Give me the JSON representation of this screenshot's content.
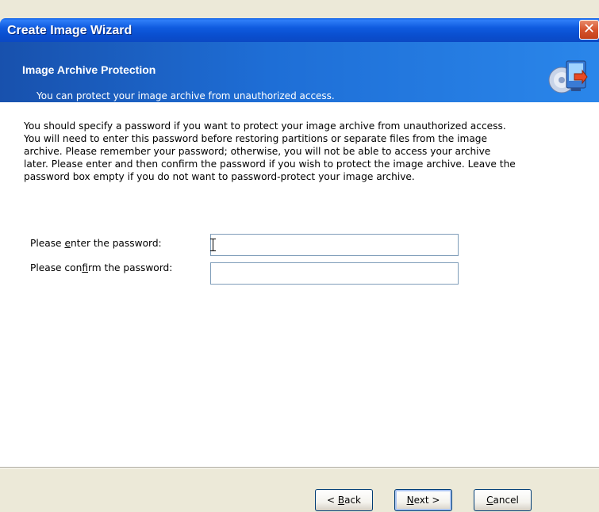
{
  "window": {
    "title": "Create Image Wizard",
    "close_glyph": "✕"
  },
  "header": {
    "title": "Image Archive Protection",
    "subtitle": "You can protect your image archive from unauthorized access.",
    "icon": "disc-computer-icon"
  },
  "description": {
    "lines": [
      "You should specify a password if you want to protect your image archive from unauthorized access.",
      "You will need to enter this password before restoring partitions or separate files from the image",
      "archive. Please remember your password; otherwise, you will not be able to access your archive",
      "later. Please enter and then confirm the password if you wish to protect the image archive. Leave the",
      "password box empty if you do not want to password-protect your image archive."
    ]
  },
  "fields": {
    "password": {
      "label_before": "Please ",
      "label_accel": "e",
      "label_after": "nter the password:",
      "value": ""
    },
    "confirm": {
      "label_before": "Please con",
      "label_accel": "f",
      "label_after": "irm the password:",
      "value": ""
    }
  },
  "buttons": {
    "back": {
      "before": "< ",
      "accel": "B",
      "after": "ack"
    },
    "next": {
      "before": "",
      "accel": "N",
      "after": "ext >"
    },
    "cancel": {
      "before": "",
      "accel": "C",
      "after": "ancel"
    }
  },
  "colors": {
    "title_bar": "#0a4fd0",
    "header": "#1e6ed6",
    "dialog_bg": "#ece9d8"
  }
}
